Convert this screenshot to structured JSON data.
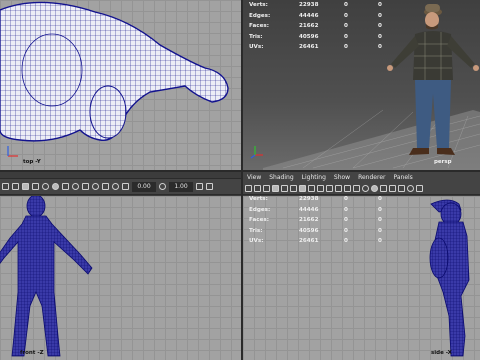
{
  "viewports": {
    "top": {
      "label": "top -Y"
    },
    "persp": {
      "label": "persp"
    },
    "front": {
      "label": "front -Z"
    },
    "side": {
      "label": "side -X"
    }
  },
  "hud": [
    {
      "label": "Verts:",
      "v1": "22938",
      "v2": "0",
      "v3": "0"
    },
    {
      "label": "Edges:",
      "v1": "44446",
      "v2": "0",
      "v3": "0"
    },
    {
      "label": "Faces:",
      "v1": "21662",
      "v2": "0",
      "v3": "0"
    },
    {
      "label": "Tris:",
      "v1": "40596",
      "v2": "0",
      "v3": "0"
    },
    {
      "label": "UVs:",
      "v1": "26461",
      "v2": "0",
      "v3": "0"
    }
  ],
  "menu": {
    "view": "View",
    "shading": "Shading",
    "lighting": "Lighting",
    "show": "Show",
    "renderer": "Renderer",
    "panels": "Panels"
  },
  "toolbar": {
    "field1": "0.00",
    "field2": "1.00"
  },
  "colors": {
    "wireframe": "#12128e",
    "grid": "#a2a2a2",
    "hud_text": "#f0f0f0",
    "x_axis": "#e03030",
    "y_axis": "#30c030",
    "z_axis": "#3060e0"
  }
}
